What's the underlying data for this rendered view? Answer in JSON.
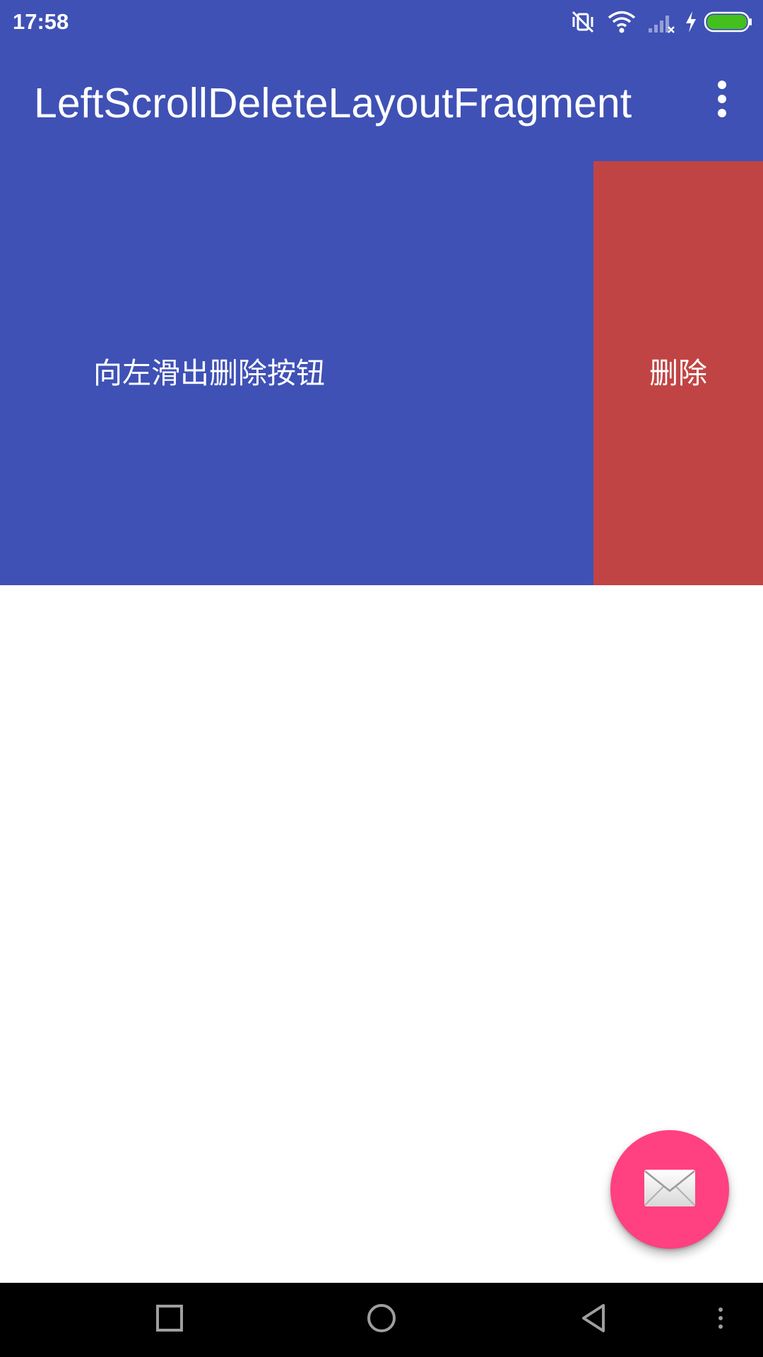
{
  "status_bar": {
    "time": "17:58",
    "icons": [
      "vibrate-off-icon",
      "wifi-icon",
      "signal-none-icon",
      "charging-icon",
      "battery-full-icon"
    ],
    "battery_color": "#43C01C"
  },
  "app_bar": {
    "title": "LeftScrollDeleteLayoutFragment",
    "menu_icon": "more-vert-icon",
    "color": "#3F51B5"
  },
  "swipe_item": {
    "text": "向左滑出删除按钮",
    "background": "#3F51B5",
    "delete_label": "删除",
    "delete_color": "#C14444"
  },
  "fab": {
    "icon": "email-icon",
    "color": "#FF4081"
  },
  "nav_bar": {
    "buttons": [
      "recents-icon",
      "home-icon",
      "back-icon",
      "menu-dots-icon"
    ]
  }
}
